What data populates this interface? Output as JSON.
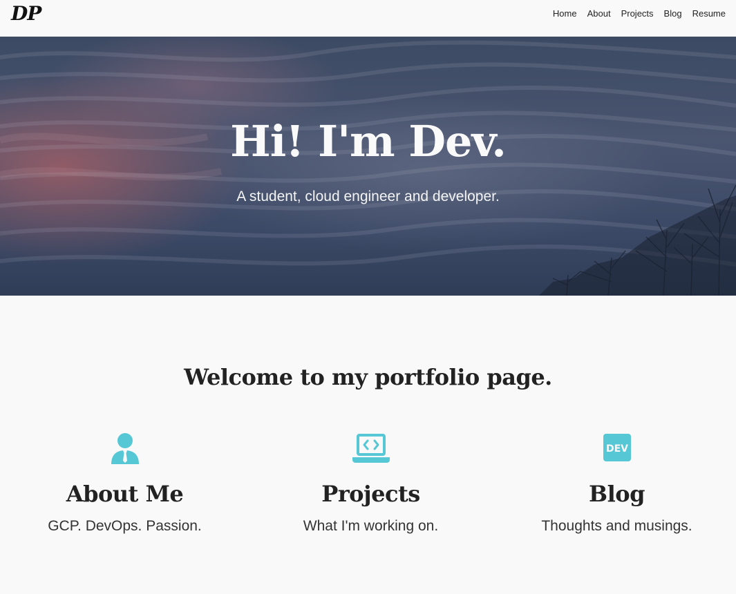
{
  "nav": {
    "logo": "DP",
    "links": [
      "Home",
      "About",
      "Projects",
      "Blog",
      "Resume"
    ]
  },
  "hero": {
    "title": "Hi! I'm Dev.",
    "subtitle": "A student, cloud engineer and developer."
  },
  "welcome": "Welcome to my portfolio page.",
  "features": [
    {
      "icon": "user-tie-icon",
      "title": "About Me",
      "description": "GCP. DevOps. Passion."
    },
    {
      "icon": "laptop-code-icon",
      "title": "Projects",
      "description": "What I'm working on."
    },
    {
      "icon": "dev-icon",
      "icon_text": "DEV",
      "title": "Blog",
      "description": "Thoughts and musings."
    }
  ],
  "colors": {
    "accent": "#56c7d4",
    "background": "#f9f9f9",
    "text": "#222222"
  }
}
